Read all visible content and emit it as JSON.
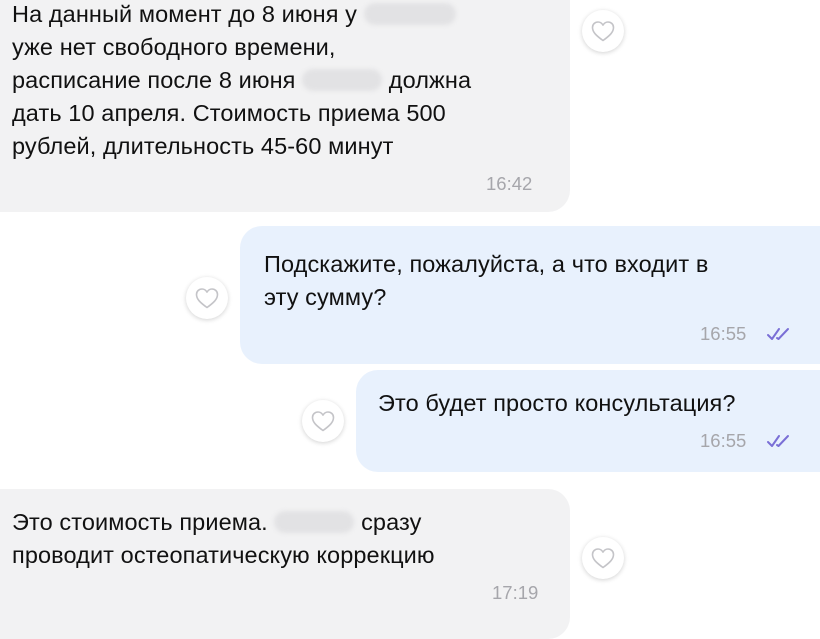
{
  "messages": [
    {
      "direction": "incoming",
      "lines": [
        "На данный момент до 8 июня у",
        "уже нет свободного времени,",
        "расписание после 8 июня",
        "должна",
        "дать 10 апреля. Стоимость приема 500",
        "рублей, длительность 45-60 минут"
      ],
      "time": "16:42"
    },
    {
      "direction": "outgoing",
      "lines": [
        "Подскажите, пожалуйста, а что входит в",
        "эту сумму?"
      ],
      "time": "16:55",
      "status": "read"
    },
    {
      "direction": "outgoing",
      "lines": [
        "Это будет просто консультация?"
      ],
      "time": "16:55",
      "status": "read"
    },
    {
      "direction": "incoming",
      "lines": [
        "Это стоимость приема.",
        "сразу",
        "проводит остеопатическую коррекцию"
      ],
      "time": "17:19"
    }
  ],
  "icons": {
    "reaction": "heart-outline-icon",
    "read_receipt": "double-check-icon"
  },
  "colors": {
    "incoming_bubble": "#f2f2f3",
    "outgoing_bubble": "#e8f1fd",
    "read_check": "#7a6fd6",
    "timestamp": "#a6a6ab"
  }
}
